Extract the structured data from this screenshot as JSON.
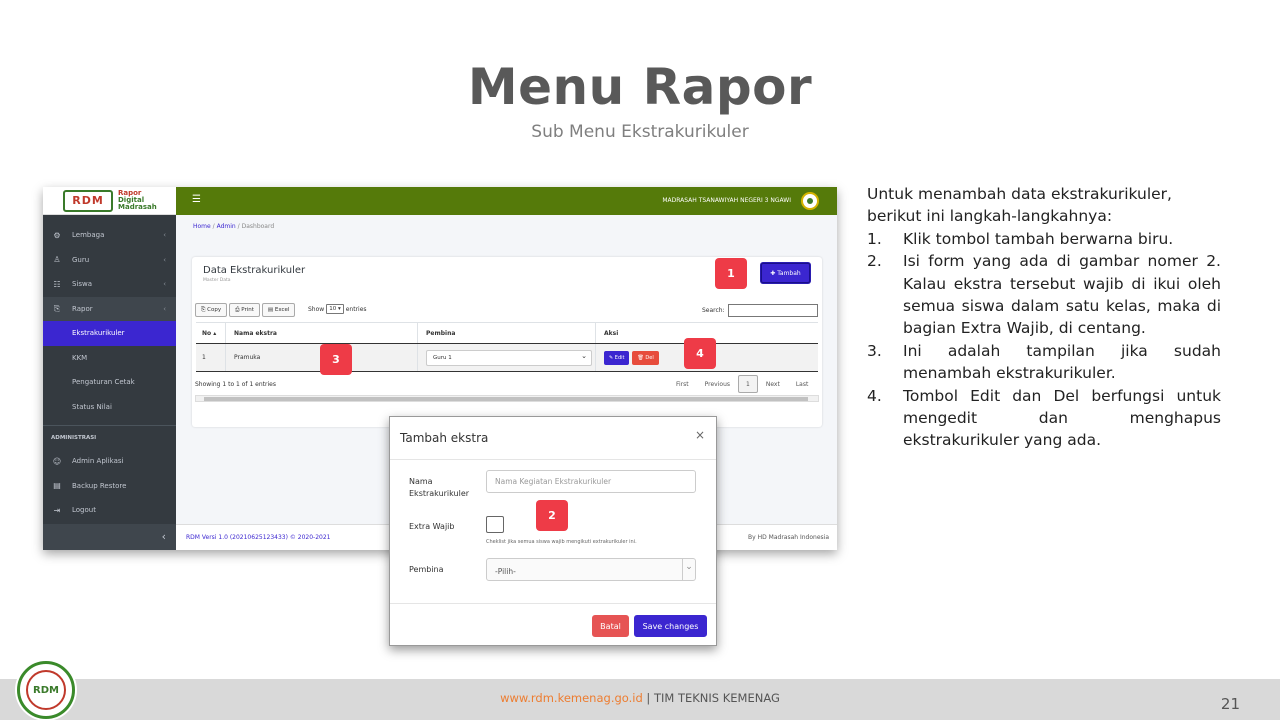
{
  "slide": {
    "title": "Menu Rapor",
    "subtitle": "Sub Menu Ekstrakurikuler",
    "page_number": "21",
    "footer_url": "www.rdm.kemenag.go.id",
    "footer_sep": "|",
    "footer_team": "TIM TEKNIS KEMENAG",
    "logo_text": "RDM"
  },
  "app": {
    "brand": {
      "logo": "RDM",
      "line1": "Rapor",
      "line2": "Digital",
      "line3": "Madrasah"
    },
    "school_name": "MADRASAH TSANAWIYAH NEGERI 3 NGAWI",
    "breadcrumb": {
      "home": "Home",
      "sep": "/",
      "admin": "Admin",
      "current": "Dashboard"
    },
    "sidebar": {
      "items": [
        {
          "label": "Lembaga",
          "icon": "⚙",
          "chev": "‹"
        },
        {
          "label": "Guru",
          "icon": "♙",
          "chev": "‹"
        },
        {
          "label": "Siswa",
          "icon": "☷",
          "chev": "‹"
        },
        {
          "label": "Rapor",
          "icon": "⎘",
          "chev": "‹"
        }
      ],
      "sub_items": [
        "Ekstrakurikuler",
        "KKM",
        "Pengaturan Cetak",
        "Status Nilai"
      ],
      "header": "ADMINISTRASI",
      "admin_items": [
        {
          "label": "Admin Aplikasi",
          "icon": "☺"
        },
        {
          "label": "Backup Restore",
          "icon": "▤"
        },
        {
          "label": "Logout",
          "icon": "⇥"
        }
      ],
      "collapse": "‹"
    },
    "card": {
      "title": "Data Ekstrakurikuler",
      "subtitle": "Master Data",
      "add_button": "✚ Tambah",
      "tools": [
        "⎘ Copy",
        "⎙ Print",
        "▤ Excel"
      ],
      "show_label": "Show",
      "show_value": "10 ▾",
      "entries_label": "entries",
      "search_label": "Search:",
      "columns": [
        "No ▴",
        "Nama ekstra",
        "Pembina",
        "Aksi"
      ],
      "row": {
        "no": "1",
        "nama": "Pramuka",
        "pembina": "Guru 1",
        "edit": "✎ Edit",
        "del": "🗑 Del"
      },
      "info": "Showing 1 to 1 of 1 entries",
      "pager": {
        "first": "First",
        "previous": "Previous",
        "current": "1",
        "next": "Next",
        "last": "Last"
      }
    },
    "footer": {
      "version": "RDM Versi 1.0 (20210625123433) © 2020-2021",
      "by": "By HD Madrasah Indonesia"
    }
  },
  "modal": {
    "title": "Tambah ekstra",
    "close": "×",
    "nama_label": "Nama Ekstrakurikuler",
    "nama_placeholder": "Nama Kegiatan Ekstrakurikuler",
    "wajib_label": "Extra Wajib",
    "wajib_help": "Cheklist jika semua siswa wajib mengikuti extrakurikuler ini.",
    "pembina_label": "Pembina",
    "pembina_value": "-Pilih-",
    "batal": "Batal",
    "save": "Save changes"
  },
  "markers": [
    "1",
    "2",
    "3",
    "4"
  ],
  "instructions": {
    "intro": "Untuk menambah data ekstrakurikuler, berikut ini langkah-langkahnya:",
    "steps": [
      {
        "n": "1.",
        "t": "Klik tombol tambah berwarna biru."
      },
      {
        "n": "2.",
        "t": "Isi form yang ada di gambar nomer 2. Kalau ekstra tersebut wajib di ikui oleh semua siswa dalam satu kelas, maka di bagian Extra Wajib, di centang."
      },
      {
        "n": "3.",
        "t": "Ini adalah tampilan jika sudah menambah ekstrakurikuler."
      },
      {
        "n": "4.",
        "t": "Tombol Edit dan Del berfungsi untuk mengedit dan menghapus ekstrakurikuler yang ada."
      }
    ]
  },
  "colors": {
    "primary": "#3b26d0",
    "topbar": "#557a0a",
    "marker": "#ee3b47",
    "sidebar": "#343a40"
  }
}
